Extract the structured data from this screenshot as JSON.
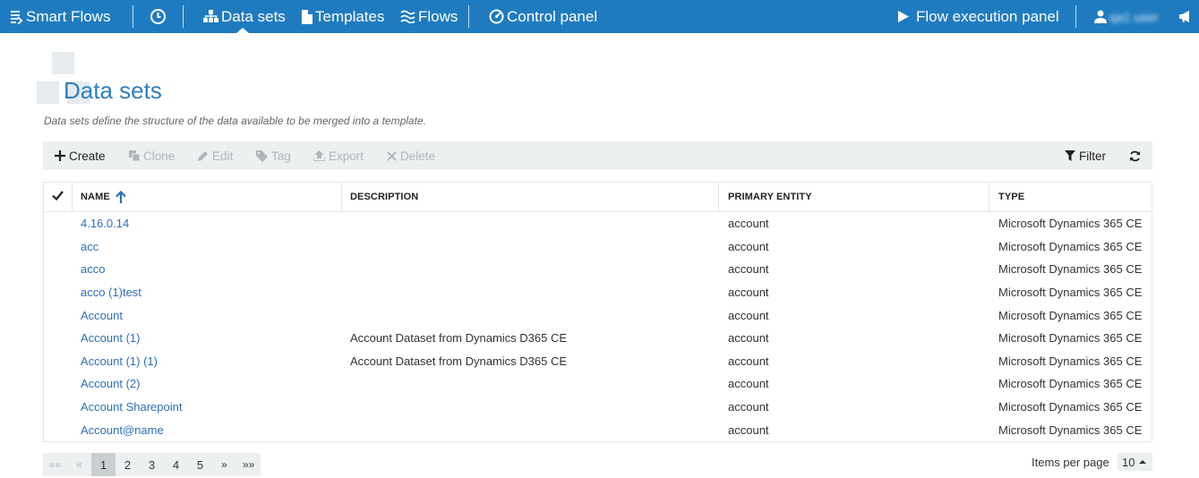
{
  "nav": {
    "brand": "Smart Flows",
    "items": [
      {
        "label": "Data sets",
        "icon": "sitemap-icon"
      },
      {
        "label": "Templates",
        "icon": "file-icon"
      },
      {
        "label": "Flows",
        "icon": "waves-icon"
      },
      {
        "label": "Control panel",
        "icon": "gauge-icon"
      }
    ],
    "execution_panel": "Flow execution panel",
    "user": "qa1 user",
    "active_item": "Data sets",
    "bar_color": "#1f7bbf"
  },
  "page": {
    "title": "Data sets",
    "description": "Data sets define the structure of the data available to be merged into a template."
  },
  "toolbar": {
    "create": "Create",
    "clone": "Clone",
    "edit": "Edit",
    "tag": "Tag",
    "export": "Export",
    "delete": "Delete",
    "filter": "Filter"
  },
  "table": {
    "columns": [
      "NAME",
      "DESCRIPTION",
      "PRIMARY ENTITY",
      "TYPE"
    ],
    "sort_column": "NAME",
    "sort_direction": "ascending",
    "rows": [
      {
        "name": "4.16.0.14",
        "description": "",
        "entity": "account",
        "type": "Microsoft Dynamics 365 CE"
      },
      {
        "name": "acc",
        "description": "",
        "entity": "account",
        "type": "Microsoft Dynamics 365 CE"
      },
      {
        "name": "acco",
        "description": "",
        "entity": "account",
        "type": "Microsoft Dynamics 365 CE"
      },
      {
        "name": "acco (1)test",
        "description": "",
        "entity": "account",
        "type": "Microsoft Dynamics 365 CE"
      },
      {
        "name": "Account",
        "description": "",
        "entity": "account",
        "type": "Microsoft Dynamics 365 CE"
      },
      {
        "name": "Account (1)",
        "description": "Account Dataset from Dynamics D365 CE",
        "entity": "account",
        "type": "Microsoft Dynamics 365 CE"
      },
      {
        "name": "Account (1) (1)",
        "description": "Account Dataset from Dynamics D365 CE",
        "entity": "account",
        "type": "Microsoft Dynamics 365 CE"
      },
      {
        "name": "Account (2)",
        "description": "",
        "entity": "account",
        "type": "Microsoft Dynamics 365 CE"
      },
      {
        "name": "Account Sharepoint",
        "description": "",
        "entity": "account",
        "type": "Microsoft Dynamics 365 CE"
      },
      {
        "name": "Account@name",
        "description": "",
        "entity": "account",
        "type": "Microsoft Dynamics 365 CE"
      }
    ]
  },
  "pager": {
    "first": "««",
    "prev": "«",
    "pages": [
      "1",
      "2",
      "3",
      "4",
      "5"
    ],
    "current": "1",
    "next": "»",
    "last": "»»",
    "items_per_page_label": "Items per page",
    "items_per_page": "10"
  }
}
